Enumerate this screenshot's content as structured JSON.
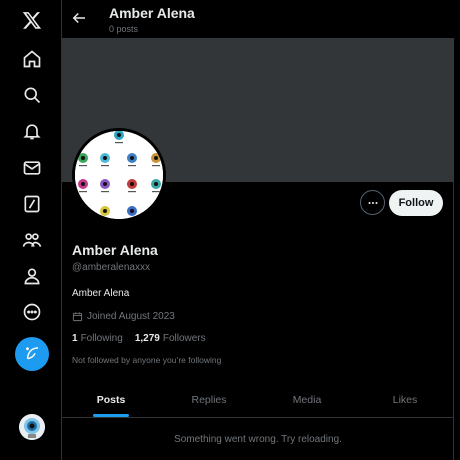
{
  "header": {
    "title": "Amber Alena",
    "subtitle": "0 posts"
  },
  "sidebar": {
    "icons": [
      "x-logo-icon",
      "home-icon",
      "search-icon",
      "notifications-bell-icon",
      "messages-envelope-icon",
      "grok-slash-icon",
      "communities-icon",
      "profile-person-icon",
      "more-circle-icon",
      "post-feather-icon"
    ]
  },
  "profile": {
    "name": "Amber Alena",
    "handle": "@amberalenaxxx",
    "bio": "Amber Alena",
    "joined": "Joined August 2023",
    "following_count": "1",
    "following_label": "Following",
    "followers_count": "1,279",
    "followers_label": "Followers",
    "not_followed": "Not followed by anyone you’re following"
  },
  "actions": {
    "follow_label": "Follow"
  },
  "tabs": [
    {
      "label": "Posts",
      "active": true
    },
    {
      "label": "Replies",
      "active": false
    },
    {
      "label": "Media",
      "active": false
    },
    {
      "label": "Likes",
      "active": false
    }
  ],
  "feed": {
    "error_message": "Something went wrong. Try reloading."
  },
  "colors": {
    "accent": "#1d9bf0",
    "banner": "#333639",
    "background": "#000000",
    "muted_text": "#71767b"
  }
}
